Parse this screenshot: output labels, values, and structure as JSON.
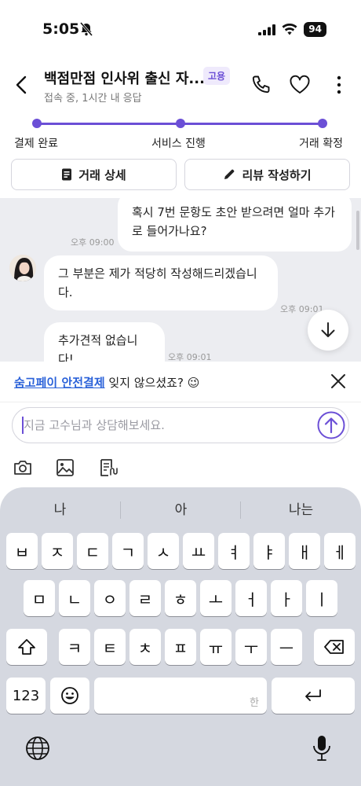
{
  "status_bar": {
    "time": "5:05",
    "battery": "94"
  },
  "header": {
    "title": "백점만점 인사위 출신 자...",
    "badge": "고용",
    "subtitle": "접속 중, 1시간 내 응답"
  },
  "progress": {
    "steps": [
      "결제 완료",
      "서비스 진행",
      "거래 확정"
    ]
  },
  "actions": {
    "details": "거래 상세",
    "review": "리뷰 작성하기"
  },
  "chat": {
    "sent_message": "혹시 7번 문항도 초안 받으려면 얼마 추가로 들어가나요?",
    "sent_time": "오후 09:00",
    "received": [
      {
        "text": "그 부분은 제가 적당히 작성해드리겠습니다.",
        "time": "오후 09:01"
      },
      {
        "text": "추가견적 없습니다!",
        "time": "오후 09:01"
      }
    ]
  },
  "banner": {
    "link": "숨고페이 안전결제",
    "text": " 잊지 않으셨죠? 😉"
  },
  "input": {
    "placeholder": "지금 고수님과 상담해보세요."
  },
  "keyboard": {
    "suggestions": [
      "나",
      "아",
      "나는"
    ],
    "row1": [
      "ㅂ",
      "ㅈ",
      "ㄷ",
      "ㄱ",
      "ㅅ",
      "ㅛ",
      "ㅕ",
      "ㅑ",
      "ㅐ",
      "ㅔ"
    ],
    "row2": [
      "ㅁ",
      "ㄴ",
      "ㅇ",
      "ㄹ",
      "ㅎ",
      "ㅗ",
      "ㅓ",
      "ㅏ",
      "ㅣ"
    ],
    "row3": [
      "ㅋ",
      "ㅌ",
      "ㅊ",
      "ㅍ",
      "ㅠ",
      "ㅜ",
      "ㅡ"
    ],
    "numbers_key": "123",
    "space_hint": "한"
  },
  "colors": {
    "accent": "#6b4fd6",
    "link": "#2b62d9",
    "chat_bg": "#ecedf1",
    "keyboard_bg": "#d5d8e0"
  }
}
